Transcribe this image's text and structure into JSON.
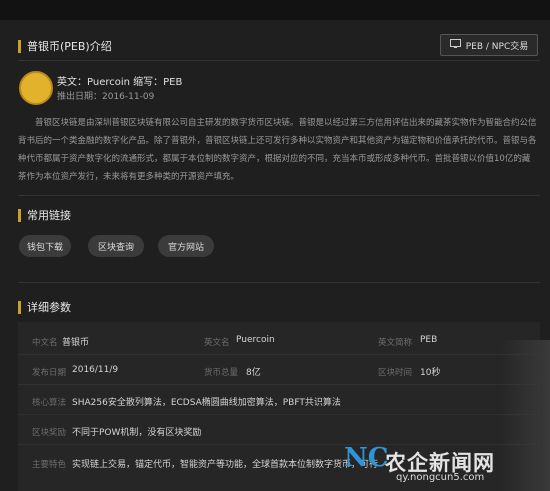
{
  "intro_section": {
    "title": "普银币(PEB)介绍",
    "trade_button": "PEB / NPC交易",
    "coin_name": "英文：Puercoin  缩写：PEB",
    "coin_date": "推出日期：2016-11-09",
    "description": "普银区块链是由深圳普银区块链有限公司自主研发的数字货币区块链。普银是以经过第三方信用评估出来的藏茶实物作为智能合约公信背书后的一个类金融的数字化产品。除了普银外，普银区块链上还可发行多种以实物资产和其他资产为锚定物和价值承托的代币。普银与各种代币都属于资产数字化的流通形式，都属于本位制的数字资产，根据对应的不同，充当本币或形成多种代币。首批普银以价值10亿的藏茶作为本位资产发行，未来将有更多种类的开源资产填充。"
  },
  "links_section": {
    "title": "常用链接",
    "buttons": [
      "钱包下载",
      "区块查询",
      "官方网站"
    ]
  },
  "params_section": {
    "title": "详细参数",
    "rows": [
      {
        "l1": "中文名",
        "v1": "普银币",
        "l2": "英文名",
        "v2": "Puercoin",
        "l3": "英文简称",
        "v3": "PEB"
      },
      {
        "l1": "发布日期",
        "v1": "2016/11/9",
        "l2": "货币总量",
        "v2": "8亿",
        "l3": "区块时间",
        "v3": "10秒"
      }
    ],
    "algo_label": "核心算法",
    "algo_value": "SHA256安全散列算法，ECDSA椭圆曲线加密算法，PBFT共识算法",
    "consensus_label": "区块奖励",
    "consensus_value": "不同于POW机制，没有区块奖励",
    "feature_label": "主要特色",
    "feature_value": "实现链上交易，锚定代币，智能资产等功能，全球首款本位制数字货币，可行"
  },
  "watermark": {
    "logo": "NC",
    "text": "农企新闻网",
    "url": "qy.nongcun5.com"
  },
  "colors": {
    "accent": "#c9a227",
    "coin": "#e3b22d",
    "watermark_blue": "#2f93d6"
  }
}
